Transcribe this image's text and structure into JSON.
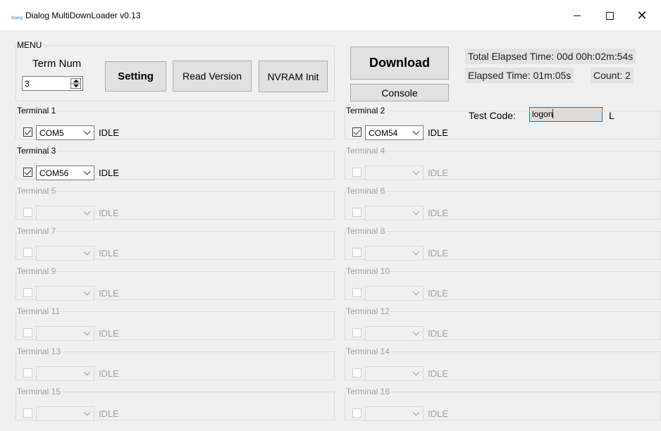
{
  "window": {
    "title": "Dialog MultiDownLoader v0.13",
    "icon": "dialog-logo-icon",
    "icon_text": "dialog"
  },
  "menu": {
    "legend": "MENU",
    "term_num_label": "Term Num",
    "term_num_value": "3",
    "setting_label": "Setting",
    "read_version_label": "Read Version",
    "nvram_init_label": "NVRAM Init"
  },
  "actions": {
    "download_label": "Download",
    "console_label": "Console"
  },
  "info": {
    "total_elapsed": "Total Elapsed Time: 00d 00h:02m:54s",
    "elapsed": "Elapsed Time: 01m:05s",
    "count": "Count: 2",
    "test_code_label": "Test Code:",
    "test_code_value": "logon",
    "test_code_suffix": "L"
  },
  "terminals": [
    {
      "label": "Terminal 1",
      "checked": true,
      "port": "COM5",
      "status": "IDLE",
      "enabled": true
    },
    {
      "label": "Terminal 2",
      "checked": true,
      "port": "COM54",
      "status": "IDLE",
      "enabled": true
    },
    {
      "label": "Terminal 3",
      "checked": true,
      "port": "COM56",
      "status": "IDLE",
      "enabled": true
    },
    {
      "label": "Terminal 4",
      "checked": false,
      "port": "",
      "status": "IDLE",
      "enabled": false
    },
    {
      "label": "Terminal 5",
      "checked": false,
      "port": "",
      "status": "IDLE",
      "enabled": false
    },
    {
      "label": "Terminal 6",
      "checked": false,
      "port": "",
      "status": "IDLE",
      "enabled": false
    },
    {
      "label": "Terminal 7",
      "checked": false,
      "port": "",
      "status": "IDLE",
      "enabled": false
    },
    {
      "label": "Terminal 8",
      "checked": false,
      "port": "",
      "status": "IDLE",
      "enabled": false
    },
    {
      "label": "Terminal 9",
      "checked": false,
      "port": "",
      "status": "IDLE",
      "enabled": false
    },
    {
      "label": "Terminal 10",
      "checked": false,
      "port": "",
      "status": "IDLE",
      "enabled": false
    },
    {
      "label": "Terminal 11",
      "checked": false,
      "port": "",
      "status": "IDLE",
      "enabled": false
    },
    {
      "label": "Terminal 12",
      "checked": false,
      "port": "",
      "status": "IDLE",
      "enabled": false
    },
    {
      "label": "Terminal 13",
      "checked": false,
      "port": "",
      "status": "IDLE",
      "enabled": false
    },
    {
      "label": "Terminal 14",
      "checked": false,
      "port": "",
      "status": "IDLE",
      "enabled": false
    },
    {
      "label": "Terminal 15",
      "checked": false,
      "port": "",
      "status": "IDLE",
      "enabled": false
    },
    {
      "label": "Terminal 16",
      "checked": false,
      "port": "",
      "status": "IDLE",
      "enabled": false
    }
  ],
  "colors": {
    "window_bg": "#f0f0f0",
    "titlebar_bg": "#ffffff",
    "focus_border": "#0078d7",
    "disabled_text": "#a0a0a0"
  }
}
